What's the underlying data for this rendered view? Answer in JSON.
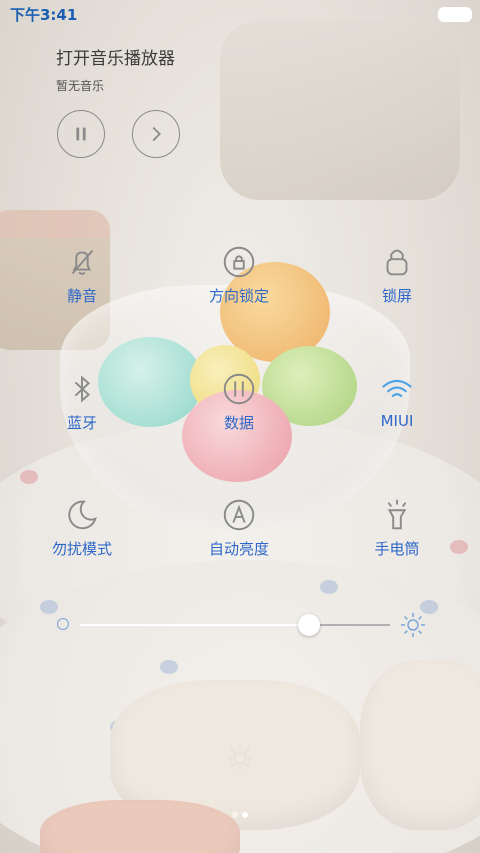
{
  "status_bar": {
    "time": "下午3:41"
  },
  "music": {
    "title": "打开音乐播放器",
    "subtitle": "暂无音乐",
    "pause_icon": "pause-icon",
    "next_icon": "chevron-right-icon"
  },
  "toggles": [
    {
      "label": "静音",
      "icon": "mute-bell-icon",
      "active": false
    },
    {
      "label": "方向锁定",
      "icon": "rotation-lock-icon",
      "active": false
    },
    {
      "label": "锁屏",
      "icon": "lock-icon",
      "active": false
    },
    {
      "label": "蓝牙",
      "icon": "bluetooth-icon",
      "active": false
    },
    {
      "label": "数据",
      "icon": "data-icon",
      "active": false
    },
    {
      "label": "MIUI",
      "icon": "wifi-icon",
      "active": true
    },
    {
      "label": "勿扰模式",
      "icon": "moon-icon",
      "active": false
    },
    {
      "label": "自动亮度",
      "icon": "auto-brightness-icon",
      "active": false
    },
    {
      "label": "手电筒",
      "icon": "flashlight-icon",
      "active": false
    }
  ],
  "brightness": {
    "level": 0.74
  },
  "settings": {
    "icon": "gear-icon"
  },
  "pager": {
    "pages": 2,
    "current": 2
  },
  "colors": {
    "accent": "#2f68c9",
    "active_icon": "#4aa3e6"
  }
}
